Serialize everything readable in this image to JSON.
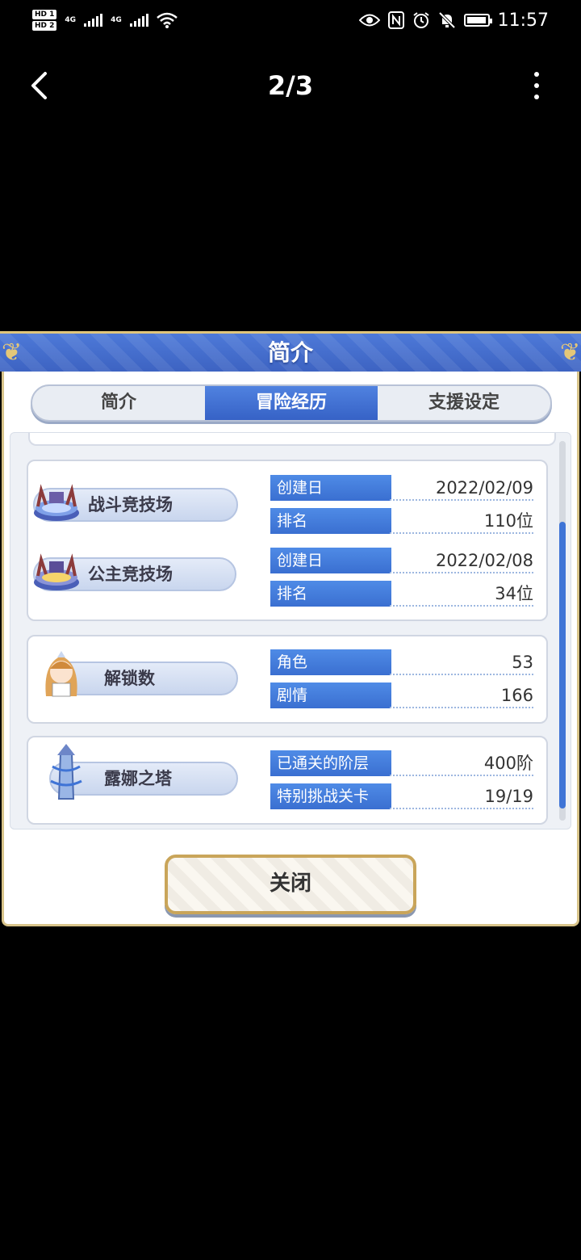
{
  "status_bar": {
    "hd1": "HD 1",
    "hd2": "HD 2",
    "net1": "4G",
    "net2": "4G",
    "time": "11:57"
  },
  "nav": {
    "back_icon": "chevron-left-icon",
    "page_counter": "2/3",
    "more_icon": "more-vertical-icon"
  },
  "dialog": {
    "title": "简介",
    "tabs": [
      {
        "label": "简介",
        "active": false
      },
      {
        "label": "冒险经历",
        "active": true
      },
      {
        "label": "支援设定",
        "active": false
      }
    ],
    "arena_battle": {
      "name": "战斗竞技场",
      "rows": [
        {
          "label": "创建日",
          "value": "2022/02/09"
        },
        {
          "label": "排名",
          "value": "110位"
        }
      ]
    },
    "arena_princess": {
      "name": "公主竞技场",
      "rows": [
        {
          "label": "创建日",
          "value": "2022/02/08"
        },
        {
          "label": "排名",
          "value": "34位"
        }
      ]
    },
    "unlocks": {
      "name": "解锁数",
      "rows": [
        {
          "label": "角色",
          "value": "53"
        },
        {
          "label": "剧情",
          "value": "166"
        }
      ]
    },
    "tower": {
      "name": "露娜之塔",
      "rows": [
        {
          "label": "已通关的阶层",
          "value": "400阶"
        },
        {
          "label": "特别挑战关卡",
          "value": "19/19"
        }
      ]
    },
    "close_label": "关闭"
  }
}
